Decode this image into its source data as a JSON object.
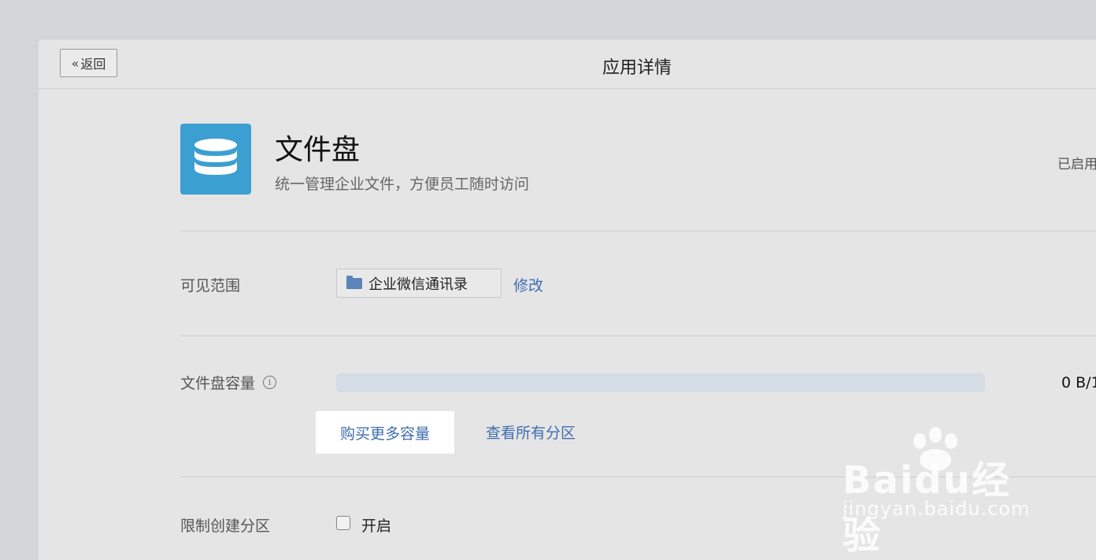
{
  "header": {
    "back_label": "返回",
    "title": "应用详情"
  },
  "app": {
    "name": "文件盘",
    "description": "统一管理企业文件，方便员工随时访问",
    "status": "已启用",
    "icon": "database-icon",
    "icon_color": "#3c9fd1"
  },
  "visibility": {
    "label": "可见范围",
    "scope": "企业微信通讯录",
    "scope_icon": "folder-icon",
    "edit_label": "修改"
  },
  "capacity": {
    "label": "文件盘容量",
    "usage_text": "0 B/1",
    "used_fraction": 0,
    "buy_label": "购买更多容量",
    "view_partitions_label": "查看所有分区"
  },
  "partition_limit": {
    "label": "限制创建分区",
    "checkbox_label": "开启",
    "checked": false
  },
  "watermark": {
    "brand": "Baidu经验",
    "url": "jingyan.baidu.com"
  }
}
